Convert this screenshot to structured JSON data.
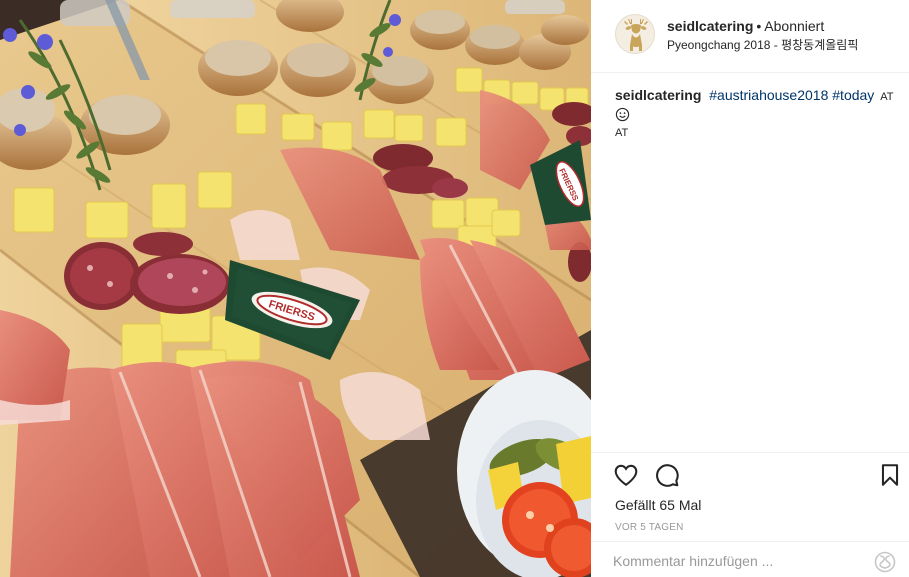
{
  "post": {
    "username": "seidlcatering",
    "separator": "•",
    "follow_status": "Abonniert",
    "location": "Pyeongchang 2018 - 평창동계올림픽"
  },
  "caption": {
    "username": "seidlcatering",
    "hashtags": [
      "#austriahouse2018",
      "#today"
    ],
    "suffix": "AT",
    "second_line": "AT"
  },
  "photo": {
    "brand_label": "FRIERSS"
  },
  "actions": {
    "likes_text": "Gefällt 65 Mal",
    "timestamp": "VOR 5 TAGEN",
    "comment_placeholder": "Kommentar hinzufügen ..."
  },
  "icons": {
    "avatar": "deer-logo-icon",
    "like": "heart-icon",
    "comment": "speech-bubble-icon",
    "save": "bookmark-icon",
    "emoji": "smile-icon",
    "more": "loading-spinner-icon"
  },
  "colors": {
    "hashtag": "#003569",
    "muted": "#999999",
    "divider": "#efefef",
    "avatar_gold": "#c9a45b"
  }
}
